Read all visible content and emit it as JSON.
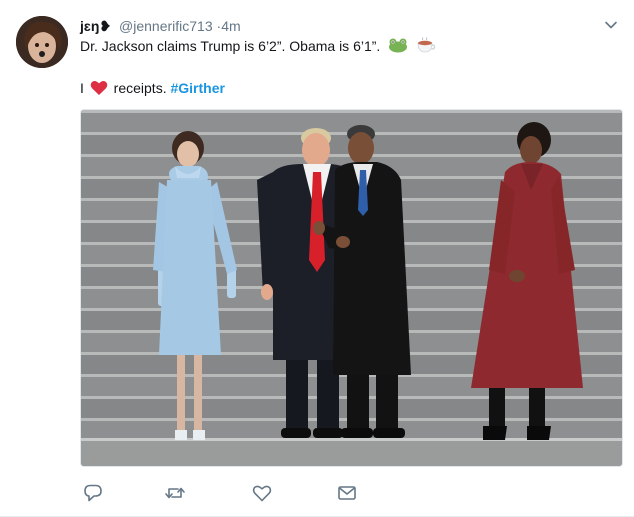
{
  "tweet": {
    "display_name": "jɛŋ❥",
    "handle": "@jennerific713",
    "separator": "·",
    "time": "4m",
    "line1": "Dr. Jackson claims Trump is 6’2”. Obama is 6’1”.",
    "line1_emojis": [
      "frog-emoji",
      "tea-cup-emoji"
    ],
    "line2_start": "I",
    "line2_heart": "heart-emoji",
    "line2_end": "receipts.",
    "hashtag": "#Girther"
  },
  "actions": [
    "reply-icon",
    "retweet-icon",
    "like-icon",
    "direct-message-icon"
  ],
  "colors": {
    "link": "#1b95e0",
    "muted": "#657786",
    "heart": "#e0245e"
  }
}
